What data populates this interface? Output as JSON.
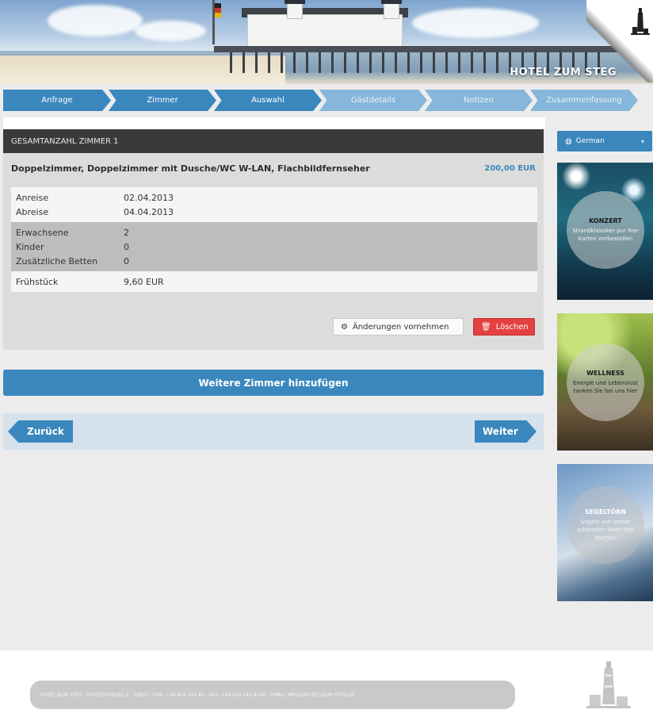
{
  "header": {
    "hotel_name": "HOTEL ZUM STEG"
  },
  "steps": [
    {
      "label": "Anfrage",
      "active": true
    },
    {
      "label": "Zimmer",
      "active": true
    },
    {
      "label": "Auswahl",
      "active": true
    },
    {
      "label": "Gästdetails",
      "active": false
    },
    {
      "label": "Notizen",
      "active": false
    },
    {
      "label": "Zusammenfassung",
      "active": false
    }
  ],
  "panel": {
    "header": "GESAMTANZAHL ZIMMER 1",
    "room_title": "Doppelzimmer, Doppelzimmer mit Dusche/WC W-LAN, Flachbildfernseher",
    "room_price": "200,00 EUR",
    "dates": {
      "arrival_label": "Anreise",
      "arrival_value": "02.04.2013",
      "departure_label": "Abreise",
      "departure_value": "04.04.2013"
    },
    "guests": {
      "adults_label": "Erwachsene",
      "adults_value": "2",
      "children_label": "Kinder",
      "children_value": "0",
      "extra_beds_label": "Zusätzliche Betten",
      "extra_beds_value": "0"
    },
    "breakfast": {
      "label": "Frühstück",
      "value": "9,60 EUR"
    },
    "change_button": "Änderungen vornehmen",
    "delete_button": "Löschen"
  },
  "add_room_button": "Weitere Zimmer hinzufügen",
  "nav": {
    "back": "Zurück",
    "next": "Weiter"
  },
  "sidebar": {
    "language": "German",
    "promos": [
      {
        "title": "KONZERT",
        "text": "Strandklassiker pur hier Karten vorbestellen"
      },
      {
        "title": "WELLNESS",
        "text": "Energie und Lebenslust tanken Sie bei uns hier"
      },
      {
        "title": "SEGELTÖRN",
        "text": "Segeln von seiner schönsten Seite hier buchen"
      }
    ]
  },
  "footer": {
    "contact": "HOTEL ZUM STEG · HOTELSTRASSE 2 · 32805 · FON: +49 432 241 82 · FAX: +49 432 241 8246 · EMAIL: INFO@HOTEL-ZUM-STEG.DE"
  },
  "colors": {
    "accent": "#3a87bd",
    "accent_inactive": "#86b6d9",
    "danger": "#e34040",
    "header_dark": "#3a3a3a"
  }
}
